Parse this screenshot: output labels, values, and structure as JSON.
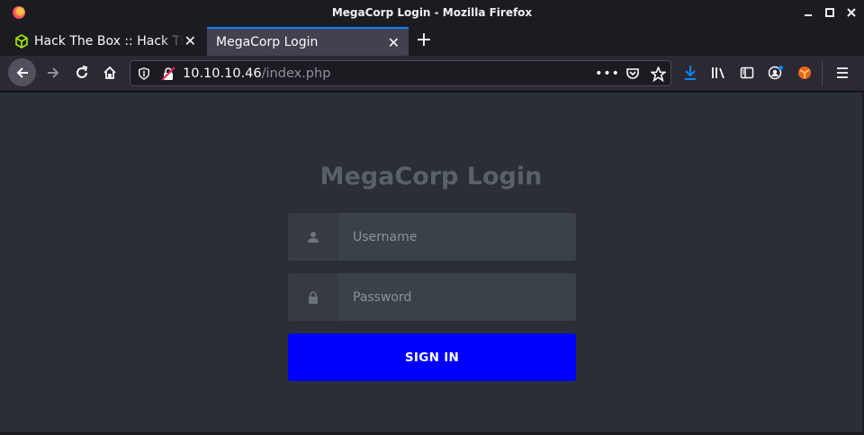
{
  "window": {
    "title": "MegaCorp Login - Mozilla Firefox",
    "controls": {
      "minimize": "_",
      "maximize": "□",
      "close": "✕"
    }
  },
  "tabs": [
    {
      "label": "Hack The Box :: Hack The Box",
      "favicon": "htb-cube-icon",
      "active": false
    },
    {
      "label": "MegaCorp Login",
      "favicon": "",
      "active": true
    }
  ],
  "navbar": {
    "url_host": "10.10.10.46",
    "url_path": "/index.php",
    "icons": [
      "back-icon",
      "forward-icon",
      "reload-icon",
      "home-icon",
      "shield-icon",
      "insecure-lock-icon",
      "page-actions-icon",
      "pocket-icon",
      "bookmark-star-icon",
      "download-icon",
      "library-icon",
      "sidebar-icon",
      "account-icon",
      "extension-icon",
      "menu-icon"
    ]
  },
  "login": {
    "heading": "MegaCorp Login",
    "username_placeholder": "Username",
    "password_placeholder": "Password",
    "signin_label": "SIGN IN"
  },
  "colors": {
    "accent_tab": "#0a84ff",
    "signin_button": "#0000ff",
    "page_background": "#2a2f36",
    "heading": "#5a6068"
  }
}
